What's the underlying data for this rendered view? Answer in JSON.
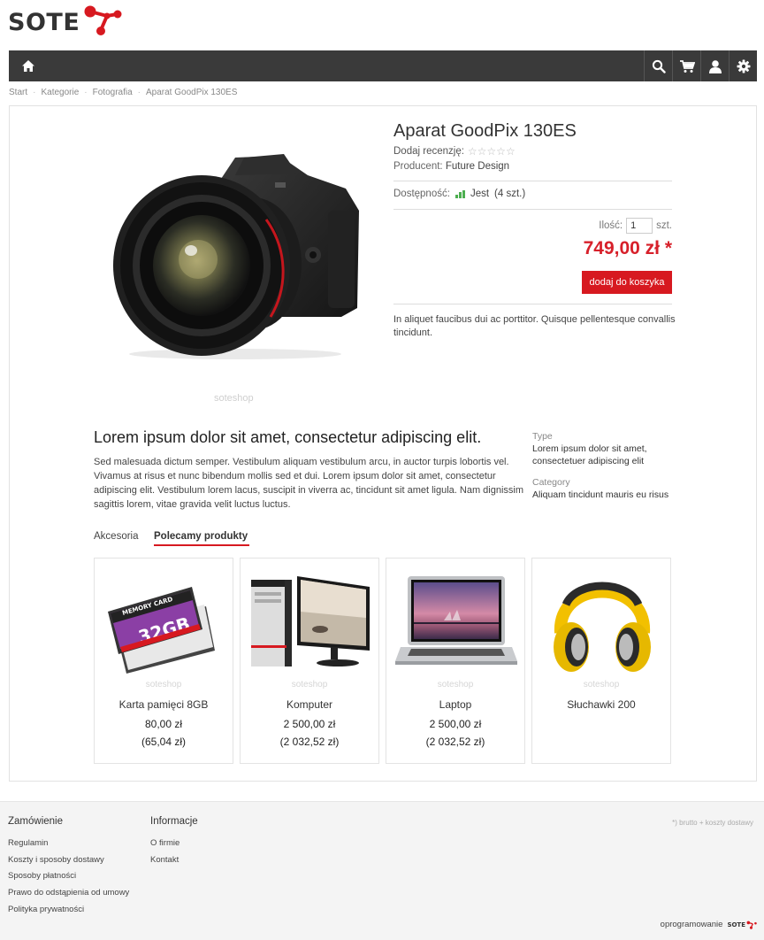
{
  "brand": {
    "logo_text": "SOTE",
    "accent": "#d71920"
  },
  "nav": {
    "icons": [
      "home-icon",
      "search-icon",
      "cart-icon",
      "user-icon",
      "gear-icon"
    ]
  },
  "breadcrumb": [
    "Start",
    "Kategorie",
    "Fotografia",
    "Aparat GoodPix 130ES"
  ],
  "product": {
    "title": "Aparat GoodPix 130ES",
    "review_label": "Dodaj recenzję:",
    "stars": "☆☆☆☆☆",
    "producer_label": "Producent:",
    "producer": "Future Design",
    "availability_label": "Dostępność:",
    "availability_value": "Jest",
    "availability_count": "(4 szt.)",
    "qty_label": "Ilość:",
    "qty_value": "1",
    "qty_unit": "szt.",
    "price": "749,00 zł *",
    "cart_button": "dodaj do koszyka",
    "short_description": "In aliquet faucibus dui ac porttitor. Quisque pellentesque convallis tincidunt.",
    "watermark": "soteshop"
  },
  "description": {
    "title": "Lorem ipsum dolor sit amet, consectetur adipiscing elit.",
    "body": "Sed malesuada dictum semper. Vestibulum aliquam vestibulum arcu, in auctor turpis lobortis vel. Vivamus at risus et nunc bibendum mollis sed et dui. Lorem ipsum dolor sit amet, consectetur adipiscing elit. Vestibulum lorem lacus, suscipit in viverra ac, tincidunt sit amet ligula. Nam dignissim sagittis lorem, vitae gravida velit luctus luctus.",
    "attributes": [
      {
        "label": "Type",
        "value": "Lorem ipsum dolor sit amet, consectetuer adipiscing elit"
      },
      {
        "label": "Category",
        "value": "Aliquam tincidunt mauris eu risus"
      }
    ]
  },
  "tabs": [
    "Akcesoria",
    "Polecamy produkty"
  ],
  "related": [
    {
      "name": "Karta pamięci 8GB",
      "price": "80,00 zł",
      "price_net": "(65,04 zł)",
      "watermark": "soteshop",
      "card_label": "MEMORY CARD",
      "card_size": "32GB"
    },
    {
      "name": "Komputer",
      "price": "2 500,00 zł",
      "price_net": "(2 032,52 zł)",
      "watermark": "soteshop"
    },
    {
      "name": "Laptop",
      "price": "2 500,00 zł",
      "price_net": "(2 032,52 zł)",
      "watermark": "soteshop"
    },
    {
      "name": "Słuchawki 200",
      "price": "",
      "price_net": "",
      "watermark": "soteshop"
    }
  ],
  "footer": {
    "col1_title": "Zamówienie",
    "col1_links": [
      "Regulamin",
      "Koszty i sposoby dostawy",
      "Sposoby płatności",
      "Prawo do odstąpienia od umowy",
      "Polityka prywatności"
    ],
    "col2_title": "Informacje",
    "col2_links": [
      "O firmie",
      "Kontakt"
    ],
    "note": "*) brutto + koszty dostawy",
    "powered_label": "oprogramowanie",
    "powered_brand": "SOTE"
  }
}
